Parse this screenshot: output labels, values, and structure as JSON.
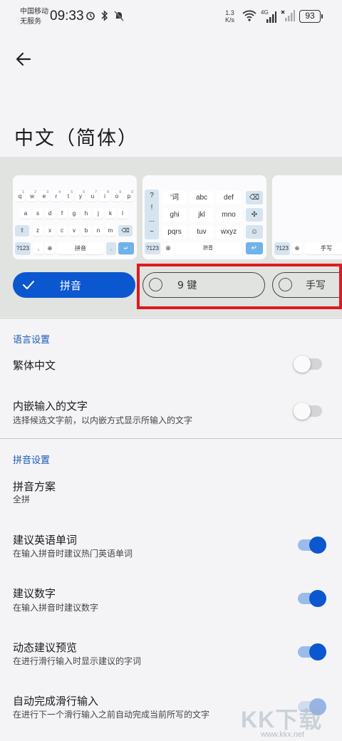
{
  "status_bar": {
    "carrier_line1": "中国移动",
    "carrier_line2": "无服务",
    "time": "09:33",
    "net_speed_value": "1.3",
    "net_speed_unit": "K/s",
    "network_type": "4G",
    "battery": "93",
    "icons_left": [
      "alarm-icon",
      "bluetooth-icon",
      "mute-bell-icon"
    ],
    "icons_right": [
      "wifi-icon",
      "signal-4g-icon",
      "signal-x-icon"
    ]
  },
  "header": {
    "back_icon": "arrow-left-icon",
    "title": "中文（简体）"
  },
  "keyboards": {
    "qwerty": {
      "row1": [
        "q",
        "w",
        "e",
        "r",
        "t",
        "y",
        "u",
        "i",
        "o",
        "p"
      ],
      "row1_digits": [
        "1",
        "2",
        "3",
        "4",
        "5",
        "6",
        "7",
        "8",
        "9",
        "0"
      ],
      "row2": [
        "a",
        "s",
        "d",
        "f",
        "g",
        "h",
        "j",
        "k",
        "l"
      ],
      "row3": [
        "z",
        "x",
        "c",
        "v",
        "b",
        "n",
        "m"
      ],
      "sym_key": "?123",
      "comma": ",",
      "space_label": "拼音"
    },
    "nine_key": {
      "side": [
        "?",
        "!",
        "...",
        "~"
      ],
      "grid": [
        "'词",
        "abc",
        "def",
        "ghi",
        "jkl",
        "mno",
        "pqrs",
        "tuv",
        "wxyz"
      ],
      "sym_key": "?123",
      "space_label": "拼音"
    },
    "handwriting": {
      "sym_key": "?123",
      "space_label": "手写"
    },
    "layouts": [
      {
        "label": "拼音",
        "selected": true
      },
      {
        "label": "9 键",
        "selected": false
      },
      {
        "label": "手写",
        "selected": false
      }
    ]
  },
  "settings": {
    "language_section": "语言设置",
    "traditional": {
      "title": "繁体中文",
      "enabled": false
    },
    "inline_text": {
      "title": "内嵌输入的文字",
      "subtitle": "选择候选文字前，以内嵌方式显示所输入的文字",
      "enabled": false
    },
    "pinyin_section": "拼音设置",
    "scheme": {
      "title": "拼音方案",
      "value": "全拼"
    },
    "suggest_english": {
      "title": "建议英语单词",
      "subtitle": "在输入拼音时建议热门英语单词",
      "enabled": true
    },
    "suggest_numbers": {
      "title": "建议数字",
      "subtitle": "在输入拼音时建议数字",
      "enabled": true
    },
    "dynamic_preview": {
      "title": "动态建议预览",
      "subtitle": "在进行滑行输入时显示建议的字词",
      "enabled": true
    },
    "auto_complete": {
      "title": "自动完成滑行输入",
      "subtitle": "在进行下一个滑行输入之前自动完成当前所写的文字",
      "enabled": true
    }
  },
  "colors": {
    "accent": "#0b57d0",
    "section_header": "#1b5bb8",
    "highlight_border": "#e0181f"
  },
  "watermark": {
    "logo": "KK下载",
    "url": "www.kkx.net"
  }
}
